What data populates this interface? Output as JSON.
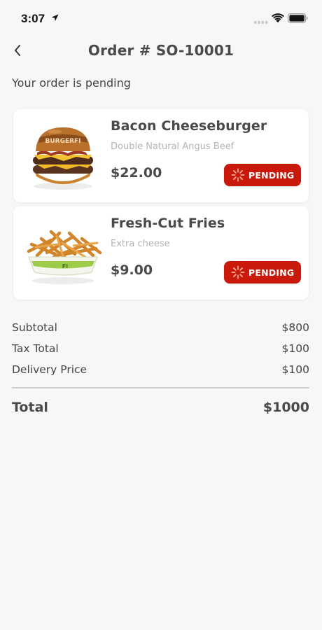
{
  "status_bar": {
    "time": "3:07"
  },
  "header": {
    "title": "Order # SO-10001",
    "back_icon": "chevron-left-icon"
  },
  "order_status_text": "Your order is pending",
  "items": [
    {
      "name": "Bacon Cheeseburger",
      "description": "Double Natural Angus Beef",
      "price": "$22.00",
      "status": "PENDING",
      "image_icon": "burger-image"
    },
    {
      "name": "Fresh-Cut Fries",
      "description": "Extra cheese",
      "price": "$9.00",
      "status": "PENDING",
      "image_icon": "fries-image"
    }
  ],
  "summary": {
    "subtotal_label": "Subtotal",
    "subtotal_value": "$800",
    "tax_label": "Tax Total",
    "tax_value": "$100",
    "delivery_label": "Delivery Price",
    "delivery_value": "$100",
    "total_label": "Total",
    "total_value": "$1000"
  },
  "colors": {
    "badge": "#c8190a",
    "background": "#f7f7f7",
    "text": "#4a4a4a",
    "muted": "#b3b3b3"
  }
}
